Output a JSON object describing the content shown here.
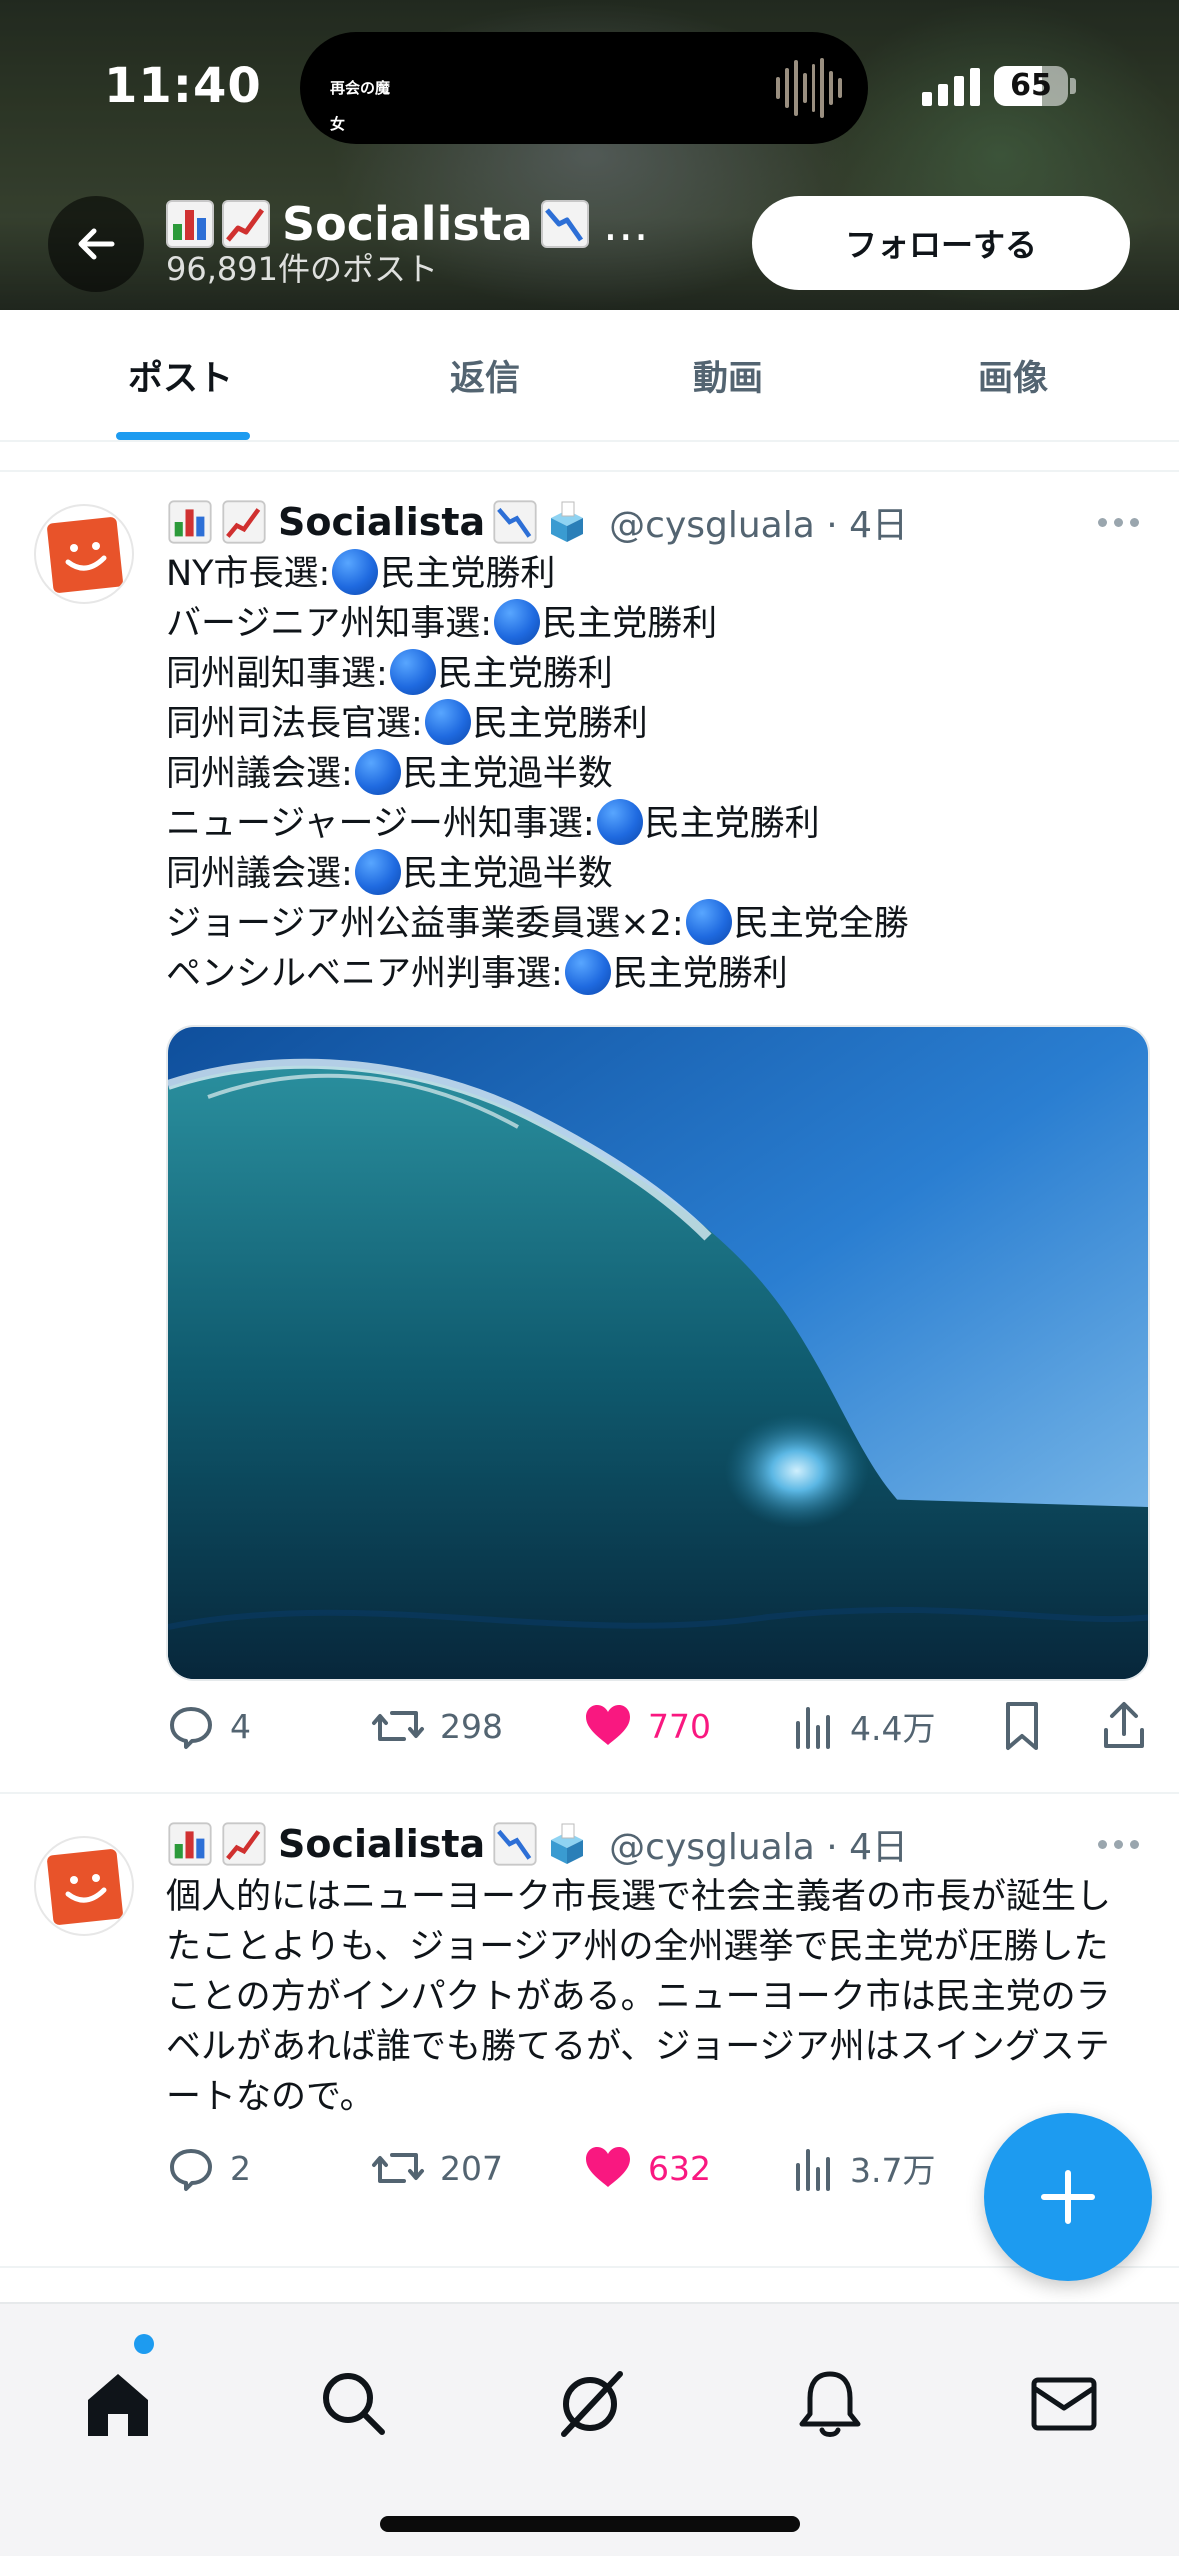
{
  "status_bar": {
    "time": "11:40",
    "battery": "65",
    "battery_level": 0.65,
    "island_label": "再会の魔女"
  },
  "header": {
    "title_name": "Socialista",
    "title_ellipsis": "…",
    "subtitle": "96,891件のポスト",
    "follow_label": "フォローする",
    "icons": [
      "back-arrow-icon",
      "bar-chart-emoji",
      "chart-increasing-emoji",
      "chart-decreasing-emoji"
    ]
  },
  "tabs": [
    {
      "label": "ポスト",
      "active": true
    },
    {
      "label": "返信",
      "active": false
    },
    {
      "label": "動画",
      "active": false
    },
    {
      "label": "画像",
      "active": false
    }
  ],
  "tweets": [
    {
      "name": "Socialista",
      "handle": "@cysgluala · 4日",
      "lines": [
        {
          "label": "NY市長選:",
          "result": "民主党勝利"
        },
        {
          "label": "バージニア州知事選:",
          "result": "民主党勝利"
        },
        {
          "label": "同州副知事選:",
          "result": "民主党勝利"
        },
        {
          "label": "同州司法長官選:",
          "result": "民主党勝利"
        },
        {
          "label": "同州議会選:",
          "result": "民主党過半数"
        },
        {
          "label": "ニュージャージー州知事選:",
          "result": "民主党勝利"
        },
        {
          "label": "同州議会選:",
          "result": "民主党過半数"
        },
        {
          "label": "ジョージア州公益事業委員選×2:",
          "result": "民主党全勝"
        },
        {
          "label": "ペンシルベニア州判事選:",
          "result": "民主党勝利"
        }
      ],
      "media": "ocean-wave-photo",
      "stats": {
        "replies": "4",
        "retweets": "298",
        "likes": "770",
        "views": "4.4万"
      }
    },
    {
      "name": "Socialista",
      "handle": "@cysgluala · 4日",
      "text_lines": [
        "個人的にはニューヨーク市長選で社会主義者の市長が誕生し",
        "たことよりも、ジョージア州の全州選挙で民主党が圧勝した",
        "ことの方がインパクトがある。ニューヨーク市は民主党のラ",
        "ベルがあれば誰でも勝てるが、ジョージア州はスイングステ",
        "ートなので。"
      ],
      "stats": {
        "replies": "2",
        "retweets": "207",
        "likes": "632",
        "views": "3.7万"
      }
    }
  ],
  "colors": {
    "accent": "#1d9bf0",
    "like": "#f91880",
    "text": "#0f1419",
    "muted": "#536471"
  },
  "bottom_nav": [
    "home-icon",
    "search-icon",
    "grok-icon",
    "notifications-bell-icon",
    "messages-envelope-icon"
  ]
}
